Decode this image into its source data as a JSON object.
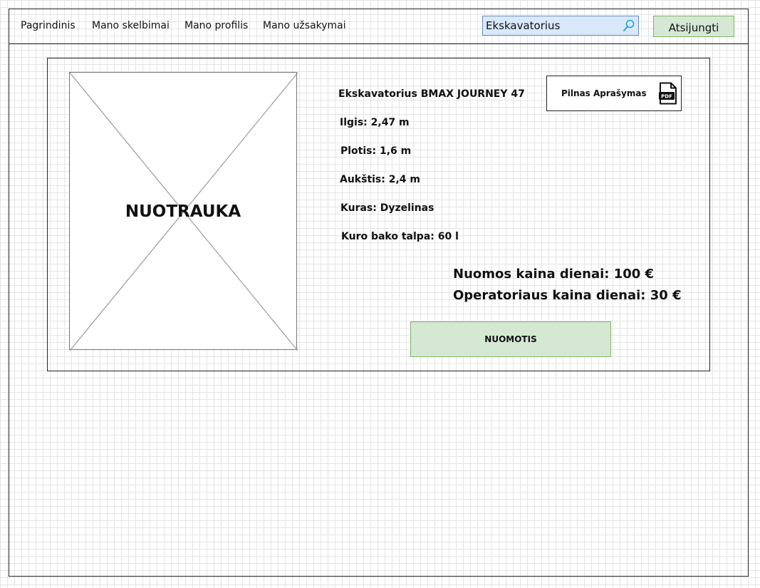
{
  "nav": {
    "items": [
      {
        "label": "Pagrindinis"
      },
      {
        "label": "Mano skelbimai"
      },
      {
        "label": "Mano profilis"
      },
      {
        "label": "Mano užsakymai"
      }
    ]
  },
  "search": {
    "value": "Ekskavatorius"
  },
  "header": {
    "logout_label": "Atsijungti"
  },
  "listing": {
    "photo_label": "NUOTRAUKA",
    "title": "Ekskavatorius BMAX JOURNEY 47",
    "specs": [
      {
        "text": "Ilgis: 2,47 m"
      },
      {
        "text": "Plotis: 1,6 m"
      },
      {
        "text": "Aukštis: 2,4 m"
      },
      {
        "text": "Kuras: Dyzelinas"
      },
      {
        "text": "Kuro bako talpa: 60 l"
      }
    ],
    "pdf_label": "Pilnas Aprašymas",
    "pdf_badge": "PDF",
    "price_rent": "Nuomos kaina dienai: 100 €",
    "price_operator": "Operatoriaus kaina dienai: 30 €",
    "rent_button": "NUOMOTIS"
  },
  "colors": {
    "search_bg": "#dae8fc",
    "search_border": "#6c8ebf",
    "button_green": "#d5e8d4",
    "button_green_border": "#82b366"
  }
}
